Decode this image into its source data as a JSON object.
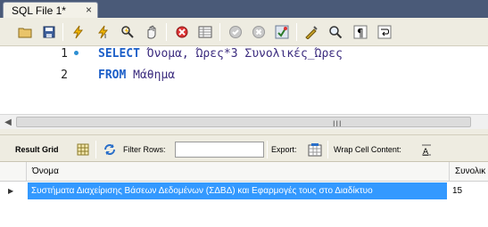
{
  "tab": {
    "title": "SQL File 1*",
    "close": "×"
  },
  "toolbar": {
    "buttons": [
      "open-folder-icon",
      "save-icon",
      "execute-icon",
      "execute-current-icon",
      "explain-icon",
      "stop-icon",
      "toggle-continue-icon",
      "toggle-output-icon",
      "commit-icon",
      "rollback-icon",
      "autocommit-icon",
      "beautify-icon",
      "find-icon",
      "invisible-chars-icon",
      "wrap-lines-icon"
    ]
  },
  "editor": {
    "line_numbers": [
      "1",
      "2"
    ],
    "lines": [
      {
        "keyword": "SELECT",
        "rest": " Όνομα, Ώρες*3 Συνολικές_Ώρες"
      },
      {
        "keyword": "FROM",
        "rest": " Μάθημα"
      }
    ]
  },
  "result_toolbar": {
    "result_grid": "Result Grid",
    "filter_rows": "Filter Rows:",
    "filter_value": "",
    "export": "Export:",
    "wrap_cell": "Wrap Cell Content:"
  },
  "grid": {
    "columns": [
      "Όνομα",
      "Συνολικ"
    ],
    "rows": [
      {
        "marker": "▶",
        "cells": [
          "Συστήματα Διαχείρισης Βάσεων Δεδομένων (ΣΔΒΔ) και Εφαρμογές τους στο Διαδίκτυο",
          "15"
        ]
      }
    ]
  },
  "scrollbar": {
    "left_arrow": "◀",
    "grip": "III"
  },
  "colors": {
    "tab_strip": "#4a5a78",
    "toolbar_bg": "#eeece1",
    "keyword": "#1c5fc8",
    "identifier": "#3b2b7e",
    "selection": "#3399ff"
  }
}
